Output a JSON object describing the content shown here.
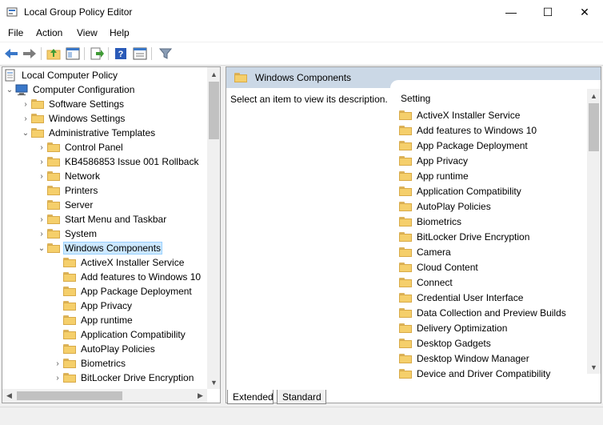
{
  "window": {
    "title": "Local Group Policy Editor",
    "minimize_glyph": "—",
    "maximize_glyph": "☐",
    "close_glyph": "✕"
  },
  "menu": [
    "File",
    "Action",
    "View",
    "Help"
  ],
  "toolbar": {
    "icons": [
      "back-icon",
      "forward-icon",
      "up-folder-icon",
      "show-hide-tree-icon",
      "export-list-icon",
      "help-icon",
      "properties-icon",
      "filter-icon"
    ]
  },
  "tree": {
    "root_label": "Local Computer Policy",
    "computer_configuration": "Computer Configuration",
    "items": [
      {
        "label": "Software Settings",
        "expander": "›"
      },
      {
        "label": "Windows Settings",
        "expander": "›"
      },
      {
        "label": "Administrative Templates",
        "expander": "⌄"
      },
      {
        "label": "Control Panel",
        "expander": "›"
      },
      {
        "label": "KB4586853 Issue 001 Rollback",
        "expander": "›"
      },
      {
        "label": "Network",
        "expander": "›"
      },
      {
        "label": "Printers",
        "expander": ""
      },
      {
        "label": "Server",
        "expander": ""
      },
      {
        "label": "Start Menu and Taskbar",
        "expander": "›"
      },
      {
        "label": "System",
        "expander": "›"
      },
      {
        "label": "Windows Components",
        "expander": "⌄"
      },
      {
        "label": "ActiveX Installer Service",
        "expander": ""
      },
      {
        "label": "Add features to Windows 10",
        "expander": ""
      },
      {
        "label": "App Package Deployment",
        "expander": ""
      },
      {
        "label": "App Privacy",
        "expander": ""
      },
      {
        "label": "App runtime",
        "expander": ""
      },
      {
        "label": "Application Compatibility",
        "expander": ""
      },
      {
        "label": "AutoPlay Policies",
        "expander": ""
      },
      {
        "label": "Biometrics",
        "expander": "›"
      },
      {
        "label": "BitLocker Drive Encryption",
        "expander": "›"
      }
    ],
    "selected": "Windows Components"
  },
  "details": {
    "header": "Windows Components",
    "description": "Select an item to view its description.",
    "column_header": "Setting",
    "settings": [
      "ActiveX Installer Service",
      "Add features to Windows 10",
      "App Package Deployment",
      "App Privacy",
      "App runtime",
      "Application Compatibility",
      "AutoPlay Policies",
      "Biometrics",
      "BitLocker Drive Encryption",
      "Camera",
      "Cloud Content",
      "Connect",
      "Credential User Interface",
      "Data Collection and Preview Builds",
      "Delivery Optimization",
      "Desktop Gadgets",
      "Desktop Window Manager",
      "Device and Driver Compatibility"
    ]
  },
  "tabs": [
    "Extended",
    "Standard"
  ],
  "colors": {
    "header_bg": "#cbd8e6",
    "selection_bg": "#cce8ff",
    "folder": "#f5cf6b"
  }
}
